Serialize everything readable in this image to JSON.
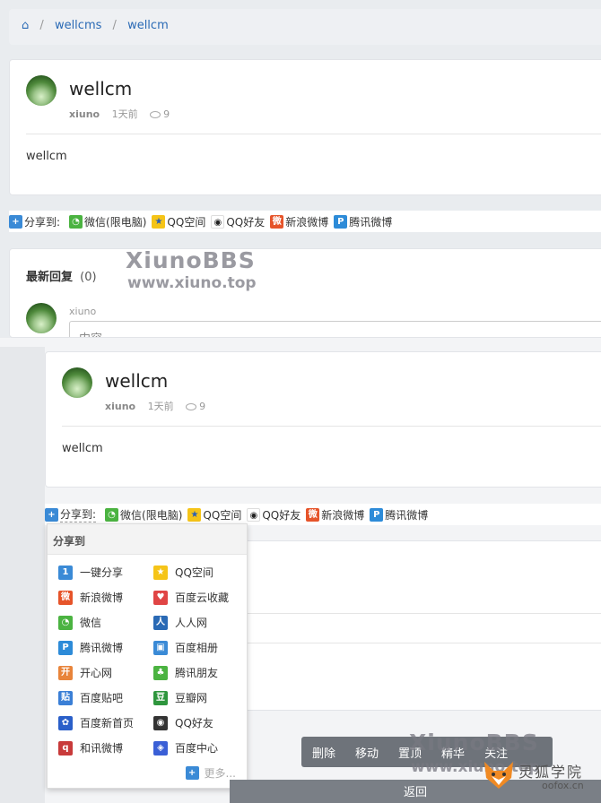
{
  "breadcrumb": {
    "home_icon": "home-icon",
    "items": [
      "wellcms",
      "wellcm"
    ]
  },
  "post": {
    "title": "wellcm",
    "author": "xiuno",
    "time": "1天前",
    "views": "9",
    "body": "wellcm"
  },
  "share": {
    "label": "分享到:",
    "items": [
      "微信(限电脑)",
      "QQ空间",
      "QQ好友",
      "新浪微博",
      "腾讯微博"
    ]
  },
  "replies": {
    "heading": "最新回复",
    "count": "(0)",
    "user": "xiuno",
    "placeholder": "内容"
  },
  "menu": {
    "title": "分享到",
    "items": [
      {
        "label": "一键分享",
        "icon": "one-key-share-icon",
        "color": "#3a8ad6",
        "glyph": "1"
      },
      {
        "label": "QQ空间",
        "icon": "qzone-icon",
        "color": "#f5c418",
        "glyph": "★"
      },
      {
        "label": "新浪微博",
        "icon": "weibo-icon",
        "color": "#e6542a",
        "glyph": "微"
      },
      {
        "label": "百度云收藏",
        "icon": "heart-icon",
        "color": "#e04545",
        "glyph": "♥"
      },
      {
        "label": "微信",
        "icon": "wechat-icon",
        "color": "#4bb341",
        "glyph": "◔"
      },
      {
        "label": "人人网",
        "icon": "renren-icon",
        "color": "#2a6ab5",
        "glyph": "人"
      },
      {
        "label": "腾讯微博",
        "icon": "tencent-weibo-icon",
        "color": "#2d8bd8",
        "glyph": "P"
      },
      {
        "label": "百度相册",
        "icon": "baidu-album-icon",
        "color": "#3a8ad6",
        "glyph": "▣"
      },
      {
        "label": "开心网",
        "icon": "kaixin-icon",
        "color": "#e8843a",
        "glyph": "开"
      },
      {
        "label": "腾讯朋友",
        "icon": "clover-icon",
        "color": "#4bb341",
        "glyph": "♣"
      },
      {
        "label": "百度贴吧",
        "icon": "tieba-icon",
        "color": "#3a7fd6",
        "glyph": "贴"
      },
      {
        "label": "豆瓣网",
        "icon": "douban-icon",
        "color": "#2e963d",
        "glyph": "豆"
      },
      {
        "label": "百度新首页",
        "icon": "paw-icon",
        "color": "#2a5fc9",
        "glyph": "✿"
      },
      {
        "label": "QQ好友",
        "icon": "qq-icon",
        "color": "#333333",
        "glyph": "◉"
      },
      {
        "label": "和讯微博",
        "icon": "hexun-icon",
        "color": "#c83a3a",
        "glyph": "q"
      },
      {
        "label": "百度中心",
        "icon": "baidu-center-icon",
        "color": "#3a5fd6",
        "glyph": "◈"
      }
    ],
    "more": "更多..."
  },
  "actions": {
    "buttons": [
      "删除",
      "移动",
      "置顶",
      "精华",
      "关注"
    ],
    "back": "返回"
  },
  "watermark": {
    "brand": "XiunoBBS",
    "site": "www.xiuno.top",
    "fox_brand": "灵狐学院",
    "fox_site": "oofox.cn"
  }
}
